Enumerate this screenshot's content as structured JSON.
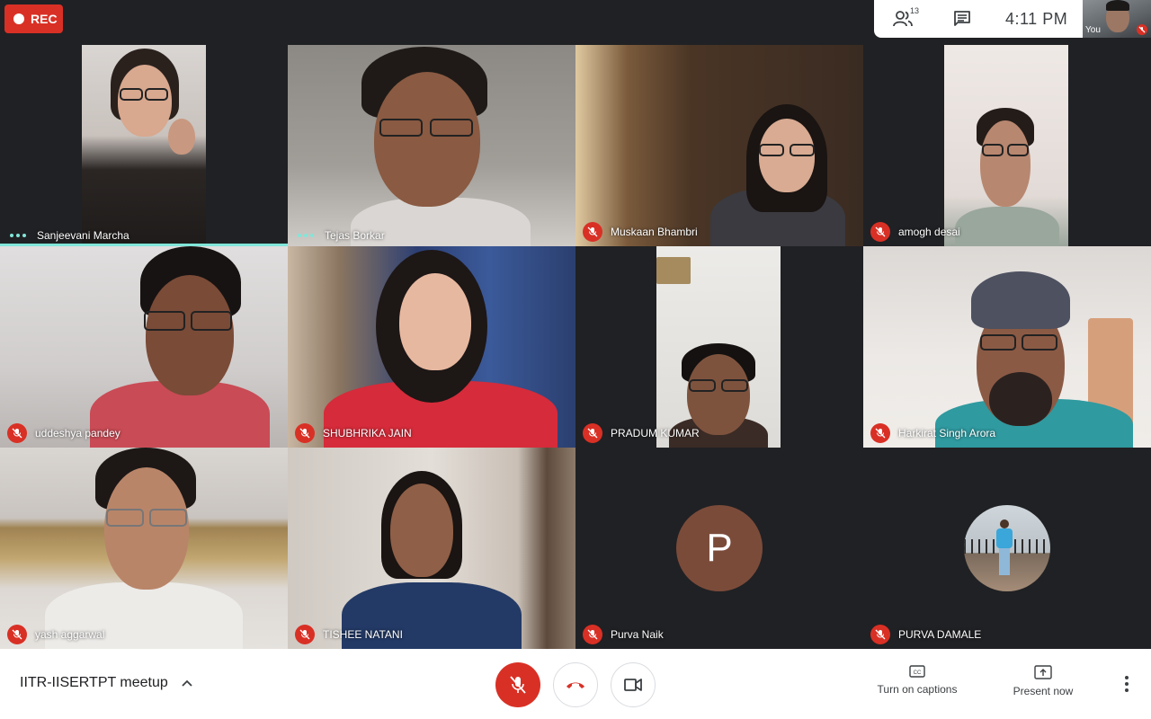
{
  "recording": {
    "label": "REC",
    "color": "#d93025"
  },
  "top_panel": {
    "participants_count": "13",
    "participants_icon": "people-icon",
    "chat_icon": "chat-icon",
    "time": "4:11 PM",
    "self_label": "You"
  },
  "participants": [
    {
      "name": "Sanjeevani Marcha",
      "status": "speaking"
    },
    {
      "name": "Tejas Borkar",
      "status": "speaking"
    },
    {
      "name": "Muskaan Bhambri",
      "status": "muted"
    },
    {
      "name": "amogh desai",
      "status": "muted"
    },
    {
      "name": "uddeshya pandey",
      "status": "muted"
    },
    {
      "name": "SHUBHRIKA JAIN",
      "status": "muted"
    },
    {
      "name": "PRADUM KUMAR",
      "status": "muted"
    },
    {
      "name": "Harkirat Singh Arora",
      "status": "muted"
    },
    {
      "name": "yash aggarwal",
      "status": "muted"
    },
    {
      "name": "TISHEE NATANI",
      "status": "muted"
    },
    {
      "name": "Purva Naik",
      "status": "muted",
      "avatar_letter": "P"
    },
    {
      "name": "PURVA DAMALE",
      "status": "muted"
    }
  ],
  "bottom_bar": {
    "meeting_name": "IITR-IISERTPT meetup",
    "captions_label": "Turn on captions",
    "present_label": "Present now"
  },
  "colors": {
    "accent_speaking": "#81e6d9",
    "muted_red": "#d93025",
    "avatar_bg": "#7b4b3a"
  }
}
